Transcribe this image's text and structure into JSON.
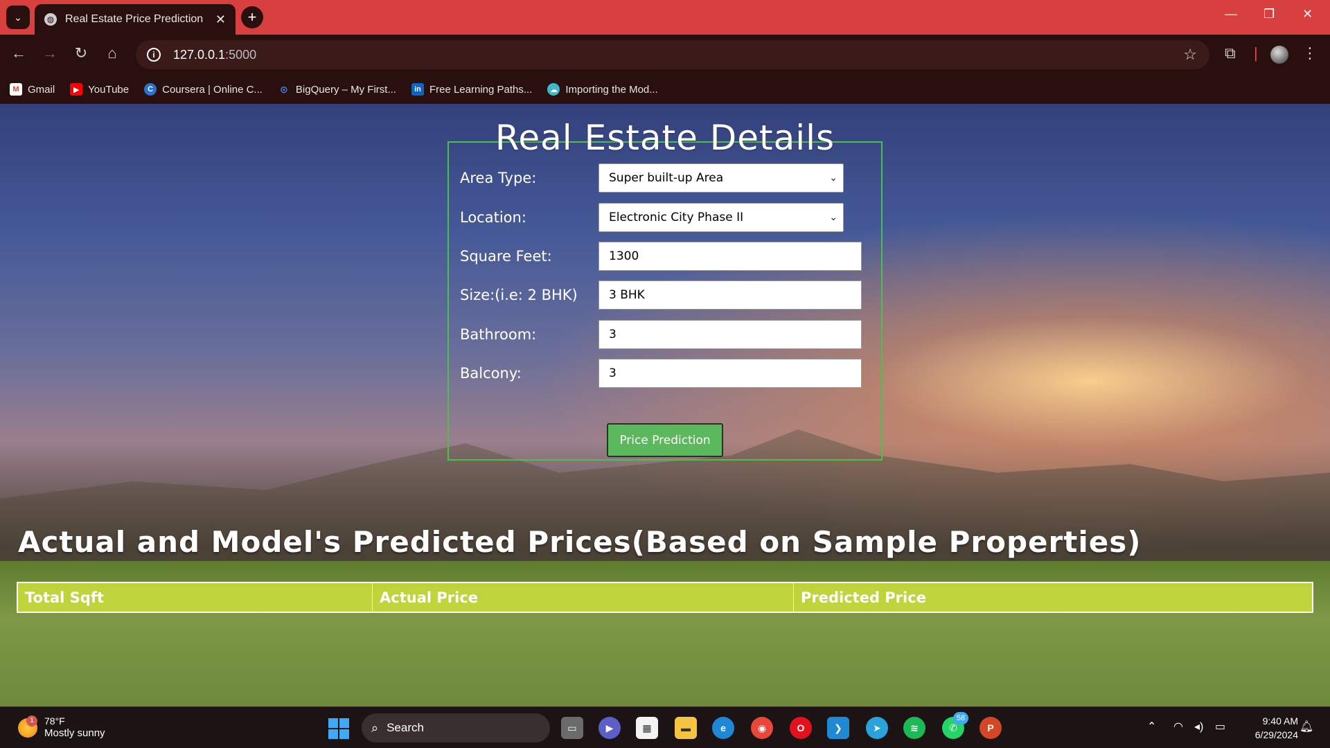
{
  "browser": {
    "tab_title": "Real Estate Price Prediction",
    "url_host": "127.0.0.1",
    "url_port": ":5000",
    "bookmarks": [
      {
        "label": "Gmail",
        "icon": "gmail-icon",
        "color": "#ea4335"
      },
      {
        "label": "YouTube",
        "icon": "youtube-icon",
        "color": "#ff0000"
      },
      {
        "label": "Coursera | Online C...",
        "icon": "coursera-icon",
        "color": "#2a73cc"
      },
      {
        "label": "BigQuery – My First...",
        "icon": "bigquery-icon",
        "color": "#4285f4"
      },
      {
        "label": "Free Learning Paths...",
        "icon": "linkedin-icon",
        "color": "#0a66c2"
      },
      {
        "label": "Importing the Mod...",
        "icon": "cloud-icon",
        "color": "#3fb6c9"
      }
    ]
  },
  "form": {
    "title": "Real Estate Details",
    "fields": {
      "area_type": {
        "label": "Area Type:",
        "value": "Super built-up Area"
      },
      "location": {
        "label": "Location:",
        "value": "Electronic City Phase II"
      },
      "sqft": {
        "label": "Square Feet:",
        "value": "1300"
      },
      "size": {
        "label": "Size:(i.e: 2 BHK)",
        "value": "3 BHK"
      },
      "bathroom": {
        "label": "Bathroom:",
        "value": "3"
      },
      "balcony": {
        "label": "Balcony:",
        "value": "3"
      }
    },
    "submit_label": "Price Prediction"
  },
  "results": {
    "title": "Actual and Model's Predicted Prices(Based on Sample Properties)",
    "columns": [
      "Total Sqft",
      "Actual Price",
      "Predicted Price"
    ]
  },
  "taskbar": {
    "weather_badge": "1",
    "temperature": "78°F",
    "condition": "Mostly sunny",
    "search_label": "Search",
    "whatsapp_badge": "58",
    "time": "9:40 AM",
    "date": "6/29/2024"
  },
  "colors": {
    "tabbar": "#d8403f",
    "chrome_dark": "#2a0f0f",
    "form_border": "#4cbf4c",
    "button": "#5cb85c",
    "table_header": "#cde13c"
  }
}
